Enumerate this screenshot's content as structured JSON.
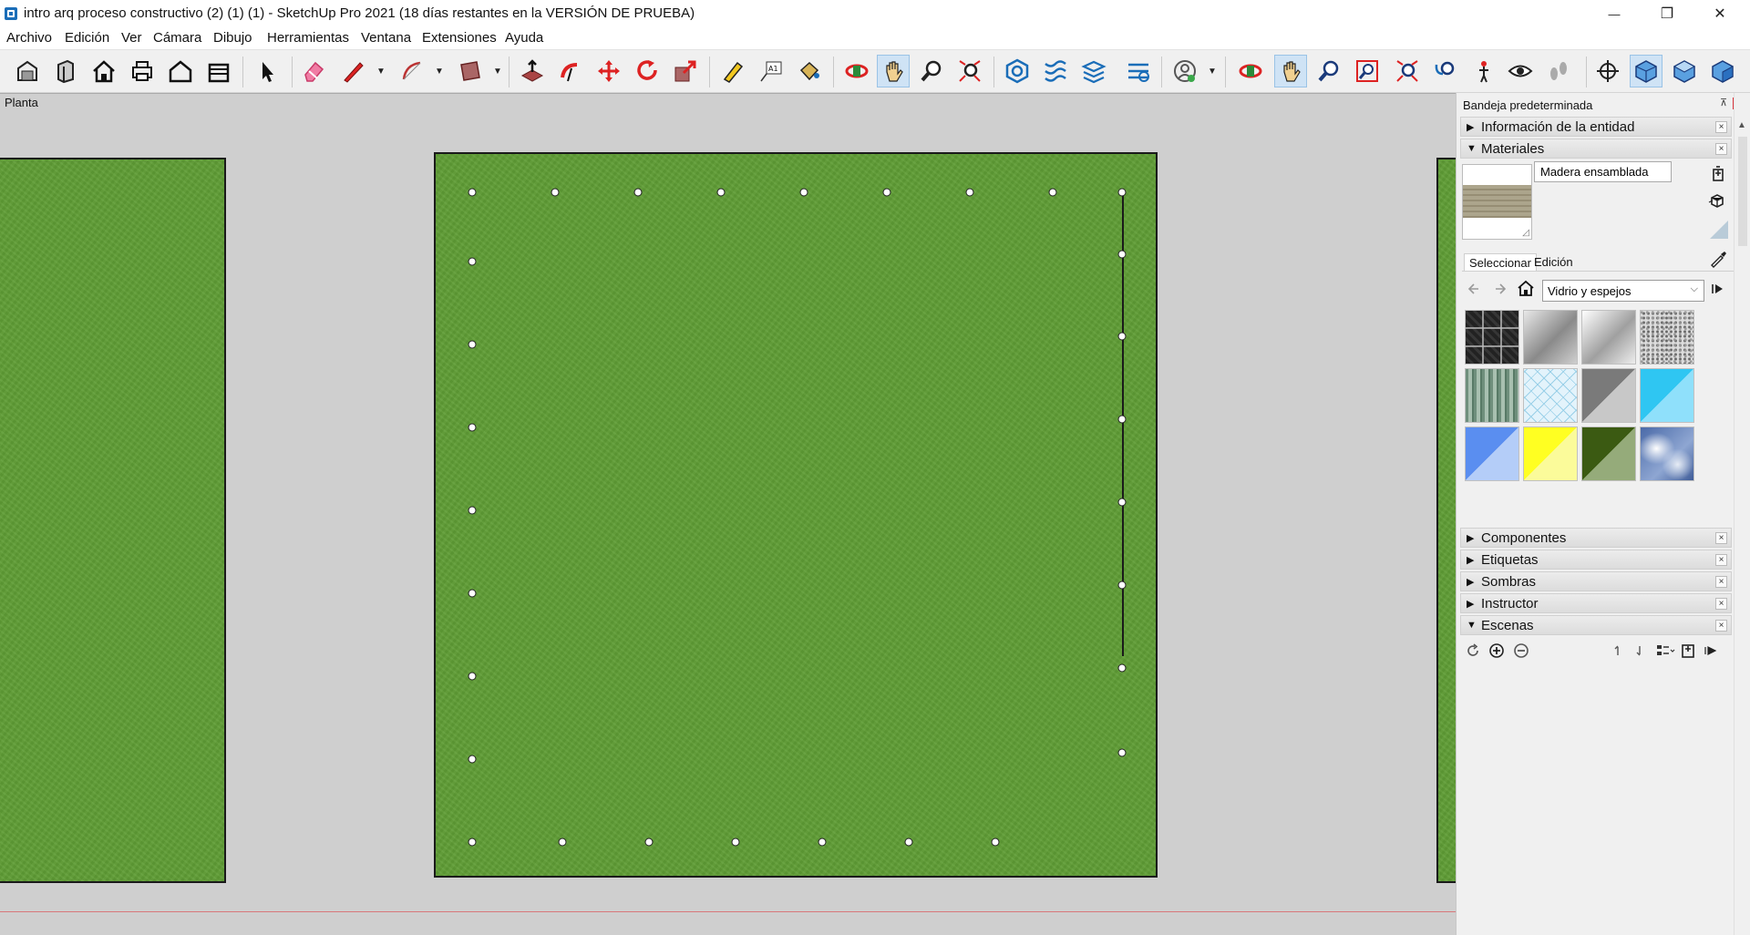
{
  "window": {
    "title": "intro arq proceso constructivo (2) (1) (1) - SketchUp Pro 2021 (18 días restantes en la VERSIÓN DE PRUEBA)",
    "controls": {
      "minimize": "—",
      "maximize": "❐",
      "close": "✕"
    }
  },
  "menu": [
    "Archivo",
    "Edición",
    "Ver",
    "Cámara",
    "Dibujo",
    "Herramientas",
    "Ventana",
    "Extensiones",
    "Ayuda"
  ],
  "toolbar_icons": [
    "warehouse-icon",
    "component-3d-icon",
    "home-view-icon",
    "print-icon",
    "house-outline-icon",
    "open-box-icon",
    "select-arrow-icon",
    "eraser-icon",
    "pencil-line-icon",
    "arc-icon",
    "rectangle-icon",
    "push-pull-icon",
    "follow-me-icon",
    "move-icon",
    "rotate-icon",
    "scale-icon",
    "tape-measure-icon",
    "text-label-icon",
    "paint-bucket-icon",
    "orbit-icon",
    "pan-hand-icon",
    "zoom-icon",
    "zoom-extents-icon",
    "solid-outer-shell-icon",
    "section-plane-icon",
    "layers-icon",
    "sandbox-icon",
    "user-account-icon",
    "orbit-color-icon",
    "pan-hand-active-icon",
    "zoom-blue-icon",
    "zoom-window-icon",
    "zoom-extents-red-icon",
    "previous-view-icon",
    "walk-position-icon",
    "look-around-icon",
    "footprints-icon",
    "axes-icon",
    "iso-view-icon",
    "top-view-icon",
    "front-view-icon"
  ],
  "viewport": {
    "scene_label": "Planta"
  },
  "tray": {
    "title": "Bandeja predeterminada",
    "pin": "⊼",
    "close": "×",
    "panels_top": [
      {
        "label": "Información de la entidad",
        "expanded": false
      },
      {
        "label": "Materiales",
        "expanded": true
      }
    ],
    "materials": {
      "current_name": "Madera ensamblada",
      "tabs": [
        "Seleccionar",
        "Edición"
      ],
      "library": "Vidrio y espejos",
      "swatches": [
        "dark-stone-tile",
        "grey-gradient",
        "light-grey-gradient",
        "speckled-granite",
        "green-striped-glass",
        "light-blue-grid",
        "grey-diagonal",
        "cyan-diagonal",
        "blue-diagonal",
        "yellow-diagonal",
        "dark-green-diagonal",
        "sky-clouds"
      ]
    },
    "panels_bottom": [
      {
        "label": "Componentes",
        "expanded": false
      },
      {
        "label": "Etiquetas",
        "expanded": false
      },
      {
        "label": "Sombras",
        "expanded": false
      },
      {
        "label": "Instructor",
        "expanded": false
      },
      {
        "label": "Escenas",
        "expanded": true
      }
    ],
    "close_mark": "×",
    "tri_collapsed": "▶",
    "tri_expanded": "▼"
  },
  "colors": {
    "grass": "#5f9d35",
    "viewport_bg": "#cfcfcf",
    "horizon": "#d8787a",
    "accent_active": "#cfe3f5"
  }
}
